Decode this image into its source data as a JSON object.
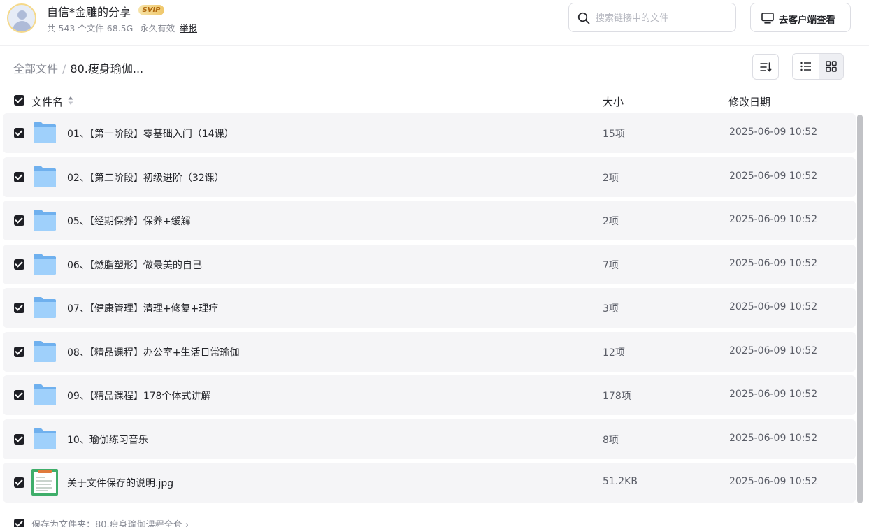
{
  "header": {
    "share_title": "自信*金雕的分享",
    "svip_badge": "SVIP",
    "file_count": "共 543 个文件 68.5G",
    "validity": "永久有效",
    "report_link": "举报",
    "search_placeholder": "搜索链接中的文件",
    "client_button": "去客户端查看"
  },
  "breadcrumb": {
    "root": "全部文件",
    "separator": "/",
    "current": "80.瘦身瑜伽..."
  },
  "table": {
    "columns": {
      "name": "文件名",
      "size": "大小",
      "date": "修改日期"
    },
    "rows": [
      {
        "name": "01、【第一阶段】零基础入门（14课）",
        "size": "15项",
        "date": "2025-06-09 10:52",
        "type": "folder"
      },
      {
        "name": "02、【第二阶段】初级进阶（32课）",
        "size": "2项",
        "date": "2025-06-09 10:52",
        "type": "folder"
      },
      {
        "name": "05、【经期保养】保养+缓解",
        "size": "2项",
        "date": "2025-06-09 10:52",
        "type": "folder"
      },
      {
        "name": "06、【燃脂塑形】做最美的自己",
        "size": "7项",
        "date": "2025-06-09 10:52",
        "type": "folder"
      },
      {
        "name": "07、【健康管理】清理+修复+理疗",
        "size": "3项",
        "date": "2025-06-09 10:52",
        "type": "folder"
      },
      {
        "name": "08、【精品课程】办公室+生活日常瑜伽",
        "size": "12项",
        "date": "2025-06-09 10:52",
        "type": "folder"
      },
      {
        "name": "09、【精品课程】178个体式讲解",
        "size": "178项",
        "date": "2025-06-09 10:52",
        "type": "folder"
      },
      {
        "name": "10、瑜伽练习音乐",
        "size": "8项",
        "date": "2025-06-09 10:52",
        "type": "folder"
      },
      {
        "name": "关于文件保存的说明.jpg",
        "size": "51.2KB",
        "date": "2025-06-09 10:52",
        "type": "image"
      }
    ]
  },
  "footer": {
    "save_to": "保存为文件夹：80.瘦身瑜伽课程全套 ›"
  },
  "colors": {
    "checkbox": "#1f2026",
    "row_bg": "#f5f5f7",
    "folder_blue": "#7fbdf2",
    "svip_gold": "#f0c76a"
  }
}
